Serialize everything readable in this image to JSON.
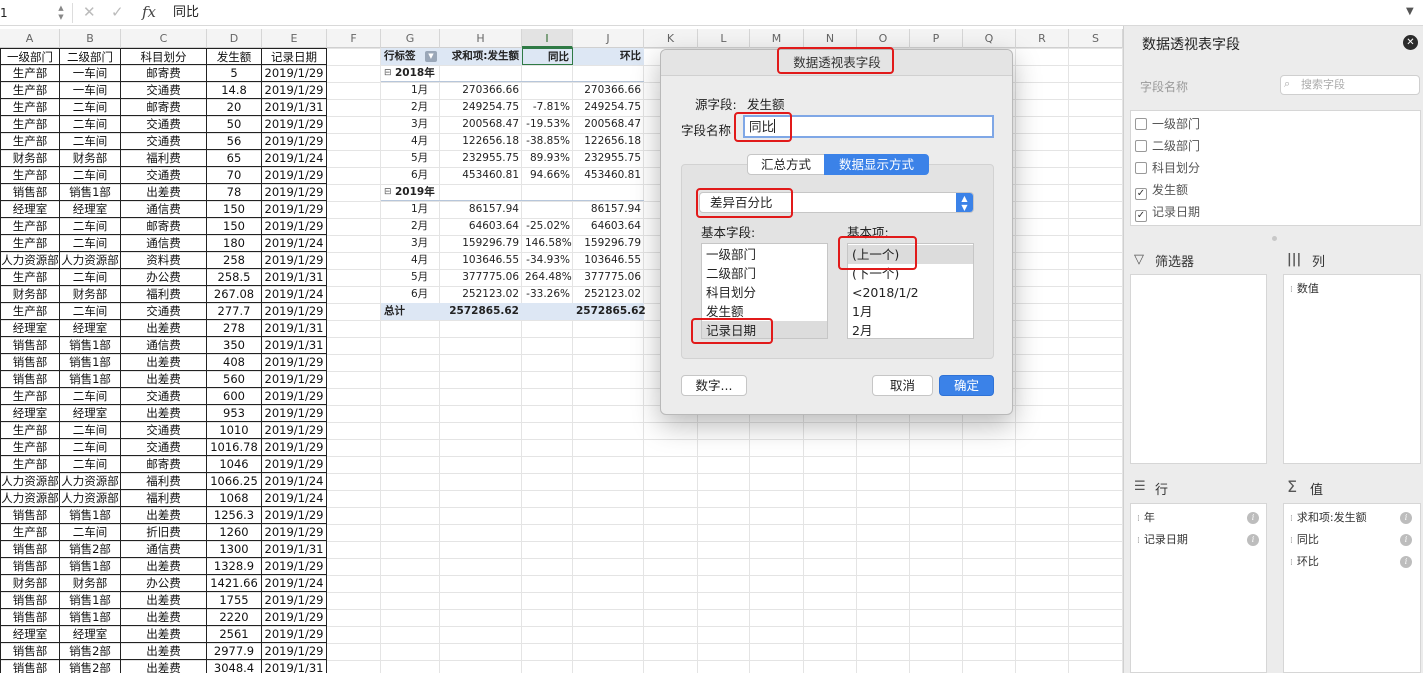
{
  "formula_bar": {
    "cell_ref": "1",
    "value": "同比"
  },
  "columns": [
    "A",
    "B",
    "C",
    "D",
    "E",
    "F",
    "G",
    "H",
    "I",
    "J",
    "K",
    "L",
    "M",
    "N",
    "O",
    "P",
    "Q",
    "R",
    "S"
  ],
  "selected_column": "I",
  "source_table": {
    "headers": [
      "一级部门",
      "二级部门",
      "科目划分",
      "发生额",
      "记录日期"
    ],
    "rows": [
      [
        "生产部",
        "一车间",
        "邮寄费",
        "5",
        "2019/1/29"
      ],
      [
        "生产部",
        "一车间",
        "交通费",
        "14.8",
        "2019/1/29"
      ],
      [
        "生产部",
        "二车间",
        "邮寄费",
        "20",
        "2019/1/31"
      ],
      [
        "生产部",
        "二车间",
        "交通费",
        "50",
        "2019/1/29"
      ],
      [
        "生产部",
        "二车间",
        "交通费",
        "56",
        "2019/1/29"
      ],
      [
        "财务部",
        "财务部",
        "福利费",
        "65",
        "2019/1/24"
      ],
      [
        "生产部",
        "二车间",
        "交通费",
        "70",
        "2019/1/29"
      ],
      [
        "销售部",
        "销售1部",
        "出差费",
        "78",
        "2019/1/29"
      ],
      [
        "经理室",
        "经理室",
        "通信费",
        "150",
        "2019/1/29"
      ],
      [
        "生产部",
        "二车间",
        "邮寄费",
        "150",
        "2019/1/29"
      ],
      [
        "生产部",
        "二车间",
        "通信费",
        "180",
        "2019/1/24"
      ],
      [
        "人力资源部",
        "人力资源部",
        "资料费",
        "258",
        "2019/1/29"
      ],
      [
        "生产部",
        "二车间",
        "办公费",
        "258.5",
        "2019/1/31"
      ],
      [
        "财务部",
        "财务部",
        "福利费",
        "267.08",
        "2019/1/24"
      ],
      [
        "生产部",
        "二车间",
        "交通费",
        "277.7",
        "2019/1/29"
      ],
      [
        "经理室",
        "经理室",
        "出差费",
        "278",
        "2019/1/31"
      ],
      [
        "销售部",
        "销售1部",
        "通信费",
        "350",
        "2019/1/31"
      ],
      [
        "销售部",
        "销售1部",
        "出差费",
        "408",
        "2019/1/29"
      ],
      [
        "销售部",
        "销售1部",
        "出差费",
        "560",
        "2019/1/29"
      ],
      [
        "生产部",
        "二车间",
        "交通费",
        "600",
        "2019/1/29"
      ],
      [
        "经理室",
        "经理室",
        "出差费",
        "953",
        "2019/1/29"
      ],
      [
        "生产部",
        "二车间",
        "交通费",
        "1010",
        "2019/1/29"
      ],
      [
        "生产部",
        "二车间",
        "交通费",
        "1016.78",
        "2019/1/29"
      ],
      [
        "生产部",
        "二车间",
        "邮寄费",
        "1046",
        "2019/1/29"
      ],
      [
        "人力资源部",
        "人力资源部",
        "福利费",
        "1066.25",
        "2019/1/24"
      ],
      [
        "人力资源部",
        "人力资源部",
        "福利费",
        "1068",
        "2019/1/24"
      ],
      [
        "销售部",
        "销售1部",
        "出差费",
        "1256.3",
        "2019/1/29"
      ],
      [
        "生产部",
        "二车间",
        "折旧费",
        "1260",
        "2019/1/29"
      ],
      [
        "销售部",
        "销售2部",
        "通信费",
        "1300",
        "2019/1/31"
      ],
      [
        "销售部",
        "销售1部",
        "出差费",
        "1328.9",
        "2019/1/29"
      ],
      [
        "财务部",
        "财务部",
        "办公费",
        "1421.66",
        "2019/1/24"
      ],
      [
        "销售部",
        "销售1部",
        "出差费",
        "1755",
        "2019/1/29"
      ],
      [
        "销售部",
        "销售1部",
        "出差费",
        "2220",
        "2019/1/29"
      ],
      [
        "经理室",
        "经理室",
        "出差费",
        "2561",
        "2019/1/29"
      ],
      [
        "销售部",
        "销售2部",
        "出差费",
        "2977.9",
        "2019/1/29"
      ],
      [
        "销售部",
        "销售2部",
        "出差费",
        "3048.4",
        "2019/1/31"
      ]
    ]
  },
  "pivot": {
    "headers": [
      "行标签",
      "求和项:发生额",
      "同比",
      "环比"
    ],
    "groups": [
      {
        "label": "2018年",
        "rows": [
          [
            "1月",
            "270366.66",
            "",
            "270366.66"
          ],
          [
            "2月",
            "249254.75",
            "-7.81%",
            "249254.75"
          ],
          [
            "3月",
            "200568.47",
            "-19.53%",
            "200568.47"
          ],
          [
            "4月",
            "122656.18",
            "-38.85%",
            "122656.18"
          ],
          [
            "5月",
            "232955.75",
            "89.93%",
            "232955.75"
          ],
          [
            "6月",
            "453460.81",
            "94.66%",
            "453460.81"
          ]
        ]
      },
      {
        "label": "2019年",
        "rows": [
          [
            "1月",
            "86157.94",
            "",
            "86157.94"
          ],
          [
            "2月",
            "64603.64",
            "-25.02%",
            "64603.64"
          ],
          [
            "3月",
            "159296.79",
            "146.58%",
            "159296.79"
          ],
          [
            "4月",
            "103646.55",
            "-34.93%",
            "103646.55"
          ],
          [
            "5月",
            "377775.06",
            "264.48%",
            "377775.06"
          ],
          [
            "6月",
            "252123.02",
            "-33.26%",
            "252123.02"
          ]
        ]
      }
    ],
    "total": [
      "总计",
      "2572865.62",
      "",
      "2572865.62"
    ]
  },
  "pane": {
    "title": "数据透视表字段",
    "field_name_label": "字段名称",
    "search_placeholder": "搜索字段",
    "fields": [
      {
        "label": "一级部门",
        "checked": false
      },
      {
        "label": "二级部门",
        "checked": false
      },
      {
        "label": "科目划分",
        "checked": false
      },
      {
        "label": "发生额",
        "checked": true
      },
      {
        "label": "记录日期",
        "checked": true
      }
    ],
    "filters_label": "筛选器",
    "columns_label": "列",
    "columns_items": [
      "数值"
    ],
    "rows_label": "行",
    "rows_items": [
      "年",
      "记录日期"
    ],
    "values_label": "值",
    "values_items": [
      "求和项:发生额",
      "同比",
      "环比"
    ]
  },
  "dialog": {
    "title": "数据透视表字段",
    "source_field_label": "源字段:",
    "source_field_value": "发生额",
    "field_name_label": "字段名称",
    "field_name_value": "同比",
    "tabs": [
      "汇总方式",
      "数据显示方式"
    ],
    "active_tab": "数据显示方式",
    "show_as_value": "差异百分比",
    "base_field_label": "基本字段:",
    "base_fields": [
      "一级部门",
      "二级部门",
      "科目划分",
      "发生额",
      "记录日期"
    ],
    "base_item_label": "基本项:",
    "base_items": [
      "(上一个)",
      "(下一个)",
      "<2018/1/2",
      "1月",
      "2月"
    ],
    "number_button": "数字...",
    "cancel_button": "取消",
    "ok_button": "确定"
  },
  "colors": {
    "accent": "#3b82e8",
    "highlight_red": "#e11a1a",
    "pivot_header": "#dde7f4"
  }
}
